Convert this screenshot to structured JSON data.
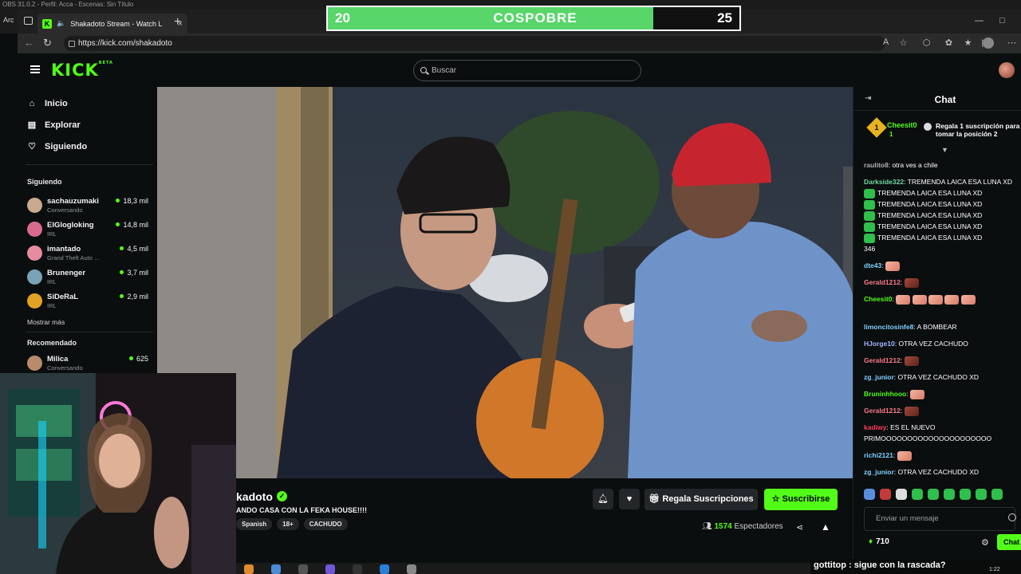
{
  "obs": {
    "title": "OBS 31.0.2 - Perfil: Acca - Escenas: Sin Título",
    "side_text": "Arc"
  },
  "browser": {
    "tab_title": "Shakadoto Stream - Watch L",
    "url": "https://kick.com/shakadoto"
  },
  "kick": {
    "logo": "KICK",
    "logo_badge": "BETA",
    "search_placeholder": "Buscar"
  },
  "sidebar": {
    "nav": [
      {
        "label": "Inicio",
        "icon": "home-icon"
      },
      {
        "label": "Explorar",
        "icon": "browse-icon"
      },
      {
        "label": "Siguiendo",
        "icon": "heart-icon"
      }
    ],
    "following_title": "Siguiendo",
    "following": [
      {
        "name": "sachauzumaki",
        "category": "Conversando",
        "viewers": "18,3 mil",
        "color": "#c9a98f"
      },
      {
        "name": "ElGlogloking",
        "category": "IRL",
        "viewers": "14,8 mil",
        "color": "#d96a8e"
      },
      {
        "name": "imantado",
        "category": "Grand Theft Auto ...",
        "viewers": "4,5 mil",
        "color": "#e58ba0"
      },
      {
        "name": "Brunenger",
        "category": "IRL",
        "viewers": "3,7 mil",
        "color": "#7aa3b8"
      },
      {
        "name": "SiDeRaL",
        "category": "IRL",
        "viewers": "2,9 mil",
        "color": "#e0a324"
      }
    ],
    "more_label": "Mostrar más",
    "recommended_title": "Recomendado",
    "recommended": [
      {
        "name": "Milica",
        "category": "Conversando",
        "viewers": "625",
        "color": "#b98a6c"
      }
    ]
  },
  "stream": {
    "streamer": "kadoto",
    "title": "ANDO CASA CON LA FEKA HOUSE!!!!",
    "tags": [
      "Spanish",
      "18+",
      "CACHUDO"
    ],
    "gift_label": "Regala Suscripciones",
    "subscribe_label": "Suscribirse",
    "viewers_number": "1574",
    "viewers_label": "Espectadores"
  },
  "chat": {
    "title": "Chat",
    "pinned": {
      "user": "Cheesit0",
      "count": "1",
      "badge_num": "1",
      "text": "Regala 1 suscripción para tomar la posición 2"
    },
    "messages": [
      {
        "user": "raulito8",
        "color": "#b0b0b0",
        "text": "otra ves a chile"
      },
      {
        "user": "Darkside322",
        "color": "#6fd6a4",
        "text": "TREMENDA LAICA ESA LUNA XD"
      },
      {
        "user": "",
        "color": "#ffffff",
        "text": "TREMENDA LAICA ESA LUNA XD"
      },
      {
        "user": "",
        "color": "#ffffff",
        "text": "TREMENDA LAICA ESA LUNA XD"
      },
      {
        "user": "",
        "color": "#ffffff",
        "text": "TREMENDA LAICA ESA LUNA XD"
      },
      {
        "user": "",
        "color": "#ffffff",
        "text": "TREMENDA LAICA ESA LUNA XD"
      },
      {
        "user": "",
        "color": "#ffffff",
        "text": "TREMENDA LAICA ESA LUNA XD"
      },
      {
        "user": "",
        "color": "#ffffff",
        "text": "346"
      },
      {
        "user": "dte43",
        "color": "#7fd0ff",
        "text": ""
      },
      {
        "user": "Gerald1212",
        "color": "#ff7a8a",
        "text": ""
      },
      {
        "user": "Cheesit0",
        "color": "#53fc18",
        "text": ""
      },
      {
        "user": "limoncitosinfe8",
        "color": "#7fd0ff",
        "text": "A BOMBEAR"
      },
      {
        "user": "HJorge10",
        "color": "#a7b4ff",
        "text": "OTRA VEZ CACHUDO"
      },
      {
        "user": "Gerald1212",
        "color": "#ff7a8a",
        "text": ""
      },
      {
        "user": "zg_junior",
        "color": "#7fd0ff",
        "text": "OTRA VEZ CACHUDO XD"
      },
      {
        "user": "Bruninhhooo",
        "color": "#53fc18",
        "text": ""
      },
      {
        "user": "Gerald1212",
        "color": "#ff7a8a",
        "text": ""
      },
      {
        "user": "kadiwy",
        "color": "#ff3b5c",
        "text": "ES EL NUEVO"
      },
      {
        "user": "",
        "color": "#ffffff",
        "text": "PRIMOOOOOOOOOOOOOOOOOOOOO"
      },
      {
        "user": "richi2121",
        "color": "#7fd0ff",
        "text": ""
      },
      {
        "user": "zg_junior",
        "color": "#7fd0ff",
        "text": "OTRA VEZ CACHUDO XD"
      }
    ],
    "input_placeholder": "Enviar un mensaje",
    "points": "710",
    "send_label": "Chat"
  },
  "scoreboard": {
    "left_score": "20",
    "label": "COSPOBRE",
    "right_score": "25",
    "left_share": 0.79,
    "fill_color": "#58d669"
  },
  "alert": {
    "text": "gottitop : sigue con la rascada?"
  },
  "clock": "1:22"
}
